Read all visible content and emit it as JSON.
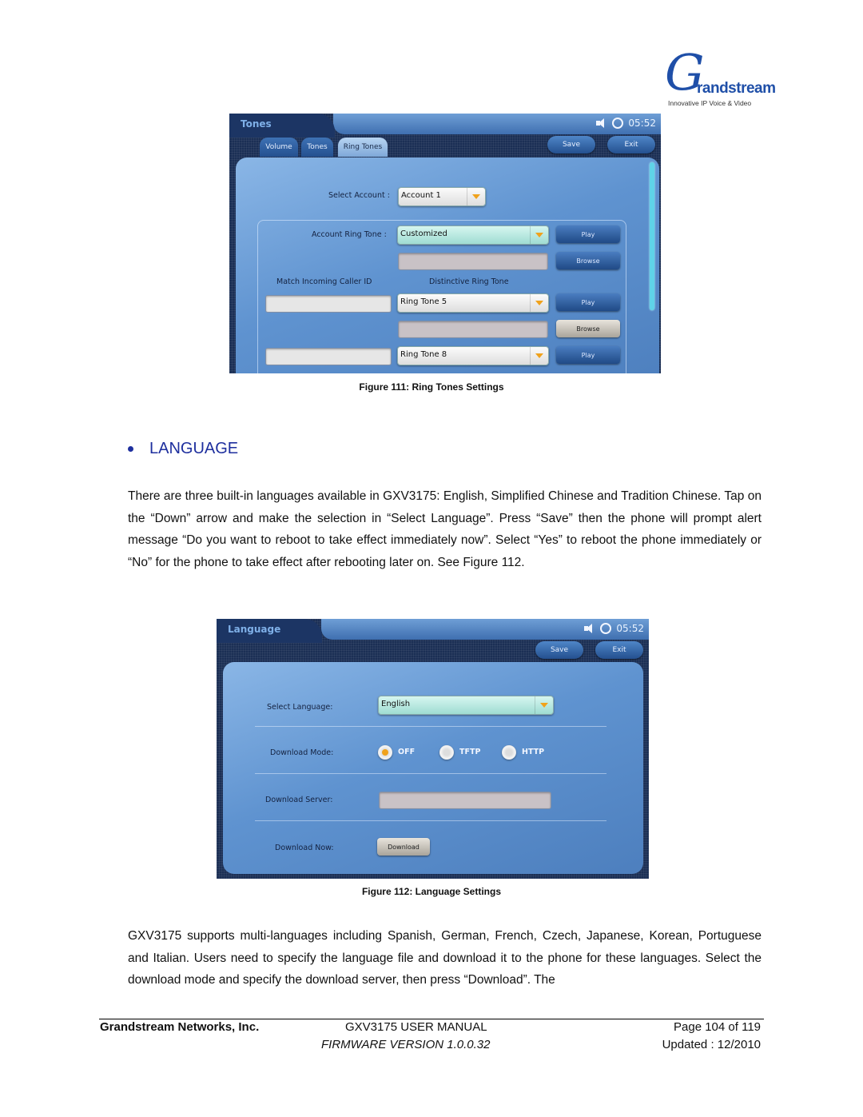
{
  "logo": {
    "brand": "randstream",
    "initial": "G",
    "tagline": "Innovative IP Voice & Video"
  },
  "figure111": {
    "screen": {
      "title": "Tones",
      "time": "05:52",
      "status_icons": [
        "speaker-icon",
        "sync-icon"
      ],
      "buttons": {
        "save": "Save",
        "exit": "Exit"
      },
      "tabs": [
        {
          "label": "Volume",
          "active": false
        },
        {
          "label": "Tones",
          "active": false
        },
        {
          "label": "Ring Tones",
          "active": true
        }
      ],
      "select_account": {
        "label": "Select Account :",
        "value": "Account 1"
      },
      "account_ring_tone": {
        "label": "Account Ring Tone :",
        "value": "Customized",
        "play": "Play",
        "browse": "Browse",
        "file_value": ""
      },
      "headers": {
        "caller_id": "Match Incoming Caller ID",
        "distinctive": "Distinctive Ring Tone"
      },
      "rows": [
        {
          "caller_id": "",
          "ring_tone": "Ring Tone 5",
          "play": "Play",
          "browse": "Browse"
        },
        {
          "caller_id": "",
          "ring_tone": "Ring Tone 8",
          "play": "Play"
        }
      ]
    },
    "caption": "Figure 111: Ring Tones Settings"
  },
  "section": {
    "heading": "LANGUAGE",
    "paragraph1": "There are three built-in languages available in GXV3175: English, Simplified Chinese and Tradition Chinese. Tap on the “Down” arrow and make the selection in “Select Language”. Press “Save” then the phone will prompt alert message “Do you want to reboot to take effect immediately now”. Select “Yes” to reboot the phone immediately or “No” for the phone to take effect after rebooting later on. See Figure 112.",
    "paragraph2": "GXV3175 supports multi-languages including Spanish, German, French, Czech, Japanese, Korean, Portuguese and Italian. Users need to specify the language file and download it to the phone for these languages. Select the download mode and specify the download server, then press “Download”. The"
  },
  "figure112": {
    "screen": {
      "title": "Language",
      "time": "05:52",
      "buttons": {
        "save": "Save",
        "exit": "Exit"
      },
      "select_language": {
        "label": "Select Language:",
        "value": "English"
      },
      "download_mode": {
        "label": "Download Mode:",
        "options": [
          "OFF",
          "TFTP",
          "HTTP"
        ],
        "selected": "OFF"
      },
      "download_server": {
        "label": "Download Server:",
        "value": ""
      },
      "download_now": {
        "label": "Download Now:",
        "button": "Download"
      }
    },
    "caption": "Figure 112: Language Settings"
  },
  "footer": {
    "company": "Grandstream Networks, Inc.",
    "manual": "GXV3175 USER MANUAL",
    "firmware": "FIRMWARE VERSION 1.0.0.32",
    "page": "Page 104 of 119",
    "updated": "Updated : 12/2010"
  }
}
